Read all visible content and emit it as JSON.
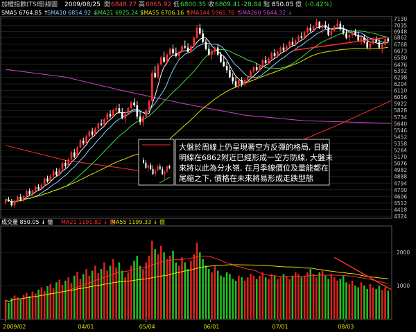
{
  "header": {
    "index_name": "加權指數(TSE)",
    "period": "日線圖",
    "date": "2009/08/25",
    "open_label": "開",
    "open": "6848.27",
    "high_label": "高",
    "high": "6865.92",
    "low_label": "低",
    "low": "6800.35",
    "close_label": "收",
    "close": "6809.41",
    "change_label": "點",
    "change": "-28.84",
    "volume": "850.05",
    "volume_unit": "億",
    "change_pct": "(-0.42%)"
  },
  "ma_legend": [
    {
      "label": "SMA5",
      "value": "6764.85",
      "arrow": "↑",
      "color": "#ffffff"
    },
    {
      "label": "SMA10",
      "value": "6854.92",
      "arrow": "↓",
      "color": "#7fd0ff"
    },
    {
      "label": "SMA21",
      "value": "6925.24",
      "arrow": "↓",
      "color": "#3fdc3f"
    },
    {
      "label": "SMA55",
      "value": "6706.16",
      "arrow": "↑",
      "color": "#e0e000"
    },
    {
      "label": "SMA144",
      "value": "5965.76",
      "arrow": "↑",
      "color": "#ff3030"
    },
    {
      "label": "SMA260",
      "value": "5644.32",
      "arrow": "↓",
      "color": "#d040d0"
    }
  ],
  "volume_legend": [
    {
      "label": "成交量",
      "value": "850.05",
      "arrow": "↓",
      "unit": "億",
      "color": "#ffffff"
    },
    {
      "label": "MA21",
      "value": "1191.82",
      "arrow": "↓",
      "unit": "億",
      "color": "#ff3030"
    },
    {
      "label": "MA55",
      "value": "1199.33",
      "arrow": "↓",
      "unit": "億",
      "color": "#e0e000"
    }
  ],
  "annotation": {
    "lines": [
      "大盤於周線上仍呈現著空方反彈的格局, 日線",
      "明線在6862附近已經形成一空方防線, 大盤未",
      "來將以此為分水嶺, 在月季線價位及量能都在",
      "尾縮之下, 價格在未來將易形成走跌型態"
    ]
  },
  "chart_data": {
    "type": "candlestick",
    "price_axis": {
      "ticks": [
        "7130",
        "7035",
        "6948",
        "6862",
        "6768",
        "6673",
        "6580",
        "6476",
        "6392",
        "6298",
        "6204",
        "6110",
        "6016",
        "5922",
        "5828",
        "5734",
        "5640",
        "5546",
        "5452",
        "5358",
        "5264",
        "5170",
        "5076",
        "4982",
        "4888",
        "4794",
        "4700",
        "4606",
        "4512",
        "4418",
        "4324"
      ],
      "range": [
        4324,
        7130
      ]
    },
    "volume_axis": {
      "ticks": [
        "2000",
        "1000"
      ],
      "range": [
        0,
        2400
      ]
    },
    "date_labels": [
      "2009/02",
      "04/01",
      "05/04",
      "06/01",
      "07/01",
      "08/03"
    ],
    "date_label_positions": [
      0,
      26.5,
      47,
      68.5,
      91.5,
      113.5
    ],
    "num_bars": 129,
    "candles": [
      [
        4520,
        4580,
        4490,
        4560
      ],
      [
        4560,
        4600,
        4530,
        4540
      ],
      [
        4540,
        4570,
        4460,
        4480
      ],
      [
        4480,
        4560,
        4450,
        4540
      ],
      [
        4540,
        4620,
        4520,
        4600
      ],
      [
        4600,
        4640,
        4540,
        4560
      ],
      [
        4560,
        4620,
        4530,
        4610
      ],
      [
        4610,
        4700,
        4600,
        4680
      ],
      [
        4680,
        4720,
        4620,
        4640
      ],
      [
        4640,
        4700,
        4610,
        4690
      ],
      [
        4690,
        4760,
        4670,
        4740
      ],
      [
        4740,
        4780,
        4690,
        4710
      ],
      [
        4710,
        4790,
        4700,
        4770
      ],
      [
        4770,
        4880,
        4760,
        4860
      ],
      [
        4860,
        4900,
        4800,
        4820
      ],
      [
        4820,
        4920,
        4810,
        4900
      ],
      [
        4900,
        4990,
        4880,
        4960
      ],
      [
        4960,
        5010,
        4890,
        4910
      ],
      [
        4910,
        5010,
        4900,
        4990
      ],
      [
        4990,
        5100,
        4980,
        5080
      ],
      [
        5080,
        5120,
        5010,
        5040
      ],
      [
        5040,
        5150,
        5030,
        5130
      ],
      [
        5130,
        5250,
        5120,
        5230
      ],
      [
        5230,
        5280,
        5150,
        5170
      ],
      [
        5170,
        5320,
        5160,
        5300
      ],
      [
        5300,
        5420,
        5290,
        5400
      ],
      [
        5400,
        5440,
        5330,
        5360
      ],
      [
        5360,
        5480,
        5350,
        5460
      ],
      [
        5460,
        5550,
        5440,
        5530
      ],
      [
        5530,
        5580,
        5460,
        5480
      ],
      [
        5480,
        5590,
        5470,
        5570
      ],
      [
        5570,
        5660,
        5550,
        5640
      ],
      [
        5640,
        5700,
        5600,
        5620
      ],
      [
        5620,
        5720,
        5600,
        5700
      ],
      [
        5700,
        5800,
        5680,
        5780
      ],
      [
        5780,
        5830,
        5720,
        5740
      ],
      [
        5740,
        5850,
        5730,
        5830
      ],
      [
        5830,
        5900,
        5790,
        5860
      ],
      [
        5860,
        5920,
        5780,
        5800
      ],
      [
        5800,
        5860,
        5700,
        5720
      ],
      [
        5720,
        5800,
        5650,
        5780
      ],
      [
        5780,
        5880,
        5760,
        5860
      ],
      [
        5860,
        5960,
        5840,
        5940
      ],
      [
        5940,
        6000,
        5880,
        5900
      ],
      [
        5900,
        5960,
        5700,
        5740
      ],
      [
        5740,
        5800,
        5620,
        5660
      ],
      [
        5660,
        5760,
        5600,
        5740
      ],
      [
        5740,
        5850,
        5720,
        5830
      ],
      [
        5830,
        5980,
        5820,
        5960
      ],
      [
        5960,
        6400,
        5950,
        6360
      ],
      [
        6360,
        6460,
        6280,
        6300
      ],
      [
        6300,
        6500,
        6280,
        6480
      ],
      [
        6480,
        6600,
        6460,
        6580
      ],
      [
        6580,
        6660,
        6500,
        6520
      ],
      [
        6520,
        6640,
        6500,
        6620
      ],
      [
        6620,
        6720,
        6600,
        6700
      ],
      [
        6700,
        6760,
        6620,
        6640
      ],
      [
        6640,
        6720,
        6580,
        6600
      ],
      [
        6600,
        6680,
        6540,
        6660
      ],
      [
        6660,
        6760,
        6640,
        6740
      ],
      [
        6740,
        6820,
        6700,
        6720
      ],
      [
        6720,
        6780,
        6640,
        6660
      ],
      [
        6660,
        6760,
        6640,
        6740
      ],
      [
        6740,
        6880,
        6720,
        6860
      ],
      [
        6860,
        7040,
        6840,
        7000
      ],
      [
        7000,
        7060,
        6900,
        6920
      ],
      [
        6920,
        6980,
        6780,
        6800
      ],
      [
        6800,
        6840,
        6680,
        6700
      ],
      [
        6700,
        6760,
        6600,
        6620
      ],
      [
        6620,
        6700,
        6540,
        6660
      ],
      [
        6660,
        6740,
        6620,
        6720
      ],
      [
        6720,
        6760,
        6600,
        6620
      ],
      [
        6620,
        6660,
        6500,
        6520
      ],
      [
        6520,
        6600,
        6440,
        6460
      ],
      [
        6460,
        6520,
        6360,
        6400
      ],
      [
        6400,
        6460,
        6280,
        6300
      ],
      [
        6300,
        6360,
        6200,
        6240
      ],
      [
        6240,
        6300,
        6150,
        6170
      ],
      [
        6170,
        6280,
        6140,
        6260
      ],
      [
        6260,
        6300,
        6160,
        6200
      ],
      [
        6200,
        6280,
        6170,
        6260
      ],
      [
        6260,
        6320,
        6220,
        6300
      ],
      [
        6300,
        6400,
        6280,
        6380
      ],
      [
        6380,
        6460,
        6360,
        6440
      ],
      [
        6440,
        6500,
        6380,
        6400
      ],
      [
        6400,
        6480,
        6380,
        6460
      ],
      [
        6460,
        6560,
        6440,
        6540
      ],
      [
        6540,
        6600,
        6480,
        6500
      ],
      [
        6500,
        6580,
        6480,
        6560
      ],
      [
        6560,
        6660,
        6540,
        6640
      ],
      [
        6640,
        6700,
        6580,
        6600
      ],
      [
        6600,
        6680,
        6580,
        6660
      ],
      [
        6660,
        6740,
        6640,
        6720
      ],
      [
        6720,
        6780,
        6660,
        6680
      ],
      [
        6680,
        6760,
        6660,
        6740
      ],
      [
        6740,
        6820,
        6720,
        6800
      ],
      [
        6800,
        6860,
        6740,
        6760
      ],
      [
        6760,
        6840,
        6740,
        6820
      ],
      [
        6820,
        6900,
        6800,
        6880
      ],
      [
        6880,
        6940,
        6840,
        6860
      ],
      [
        6860,
        6960,
        6840,
        6940
      ],
      [
        6940,
        7020,
        6920,
        7000
      ],
      [
        7000,
        7060,
        6940,
        6960
      ],
      [
        6960,
        7040,
        6940,
        7020
      ],
      [
        7020,
        7130,
        7000,
        7080
      ],
      [
        7080,
        7100,
        6980,
        7000
      ],
      [
        7000,
        7060,
        6920,
        7040
      ],
      [
        7040,
        7100,
        6980,
        7000
      ],
      [
        7000,
        7060,
        6880,
        6900
      ],
      [
        6900,
        6980,
        6840,
        6960
      ],
      [
        6960,
        7040,
        6940,
        7020
      ],
      [
        7020,
        7120,
        7000,
        7060
      ],
      [
        7060,
        7100,
        6960,
        6980
      ],
      [
        6980,
        7040,
        6900,
        6920
      ],
      [
        6920,
        6980,
        6840,
        6860
      ],
      [
        6860,
        6920,
        6800,
        6900
      ],
      [
        6900,
        6960,
        6860,
        6940
      ],
      [
        6940,
        6980,
        6880,
        6900
      ],
      [
        6900,
        6940,
        6800,
        6820
      ],
      [
        6820,
        6880,
        6760,
        6860
      ],
      [
        6860,
        6900,
        6780,
        6800
      ],
      [
        6800,
        6860,
        6700,
        6720
      ],
      [
        6720,
        6800,
        6680,
        6780
      ],
      [
        6780,
        6860,
        6760,
        6840
      ],
      [
        6840,
        6880,
        6780,
        6800
      ],
      [
        6800,
        6840,
        6700,
        6720
      ],
      [
        6720,
        6780,
        6640,
        6760
      ],
      [
        6760,
        6860,
        6740,
        6840
      ],
      [
        6848.27,
        6865.92,
        6800.35,
        6809.41
      ]
    ],
    "volume": [
      560,
      480,
      620,
      700,
      650,
      580,
      720,
      780,
      690,
      820,
      760,
      880,
      950,
      840,
      980,
      1050,
      920,
      1100,
      1180,
      1020,
      1150,
      1250,
      1080,
      1300,
      1420,
      1200,
      1350,
      1500,
      1300,
      1450,
      1600,
      1380,
      1500,
      1700,
      1450,
      1600,
      1800,
      1550,
      1700,
      1450,
      1250,
      1400,
      1600,
      1750,
      1900,
      1600,
      1500,
      1700,
      1900,
      2350,
      2100,
      1950,
      2200,
      2000,
      1800,
      1900,
      2050,
      1700,
      1600,
      1850,
      1700,
      1500,
      1750,
      1950,
      2300,
      2000,
      1800,
      1600,
      1500,
      1400,
      1600,
      1450,
      1300,
      1250,
      1400,
      1350,
      1200,
      1150,
      1300,
      1250,
      1150,
      1250,
      1350,
      1300,
      1200,
      1300,
      1400,
      1250,
      1200,
      1350,
      1300,
      1200,
      1250,
      1350,
      1280,
      1200,
      1300,
      1400,
      1350,
      1250,
      1300,
      1400,
      1500,
      1350,
      1250,
      1400,
      1450,
      1300,
      1200,
      1350,
      1250,
      1150,
      1200,
      1300,
      1100,
      1050,
      1150,
      1000,
      950,
      1100,
      1000,
      900,
      1050,
      950,
      900,
      1000,
      880,
      950,
      850.05
    ],
    "trend_lines": [
      {
        "name": "price-downtrend",
        "from": [
          96,
          6680
        ],
        "to": [
          127,
          6860
        ],
        "color": "#ff3030"
      },
      {
        "name": "volume-downtrend",
        "from": [
          110,
          1850
        ],
        "to": [
          129,
          880
        ],
        "color": "#ff3030"
      }
    ],
    "long_ma_lines": [
      {
        "name": "sma260",
        "points": [
          [
            0,
            6410
          ],
          [
            20,
            6300
          ],
          [
            40,
            6100
          ],
          [
            60,
            5920
          ],
          [
            80,
            5760
          ],
          [
            100,
            5680
          ],
          [
            129,
            5644
          ]
        ],
        "color": "#d040d0"
      },
      {
        "name": "sma144",
        "points": [
          [
            0,
            5330
          ],
          [
            20,
            5120
          ],
          [
            40,
            5000
          ],
          [
            55,
            4900
          ],
          [
            70,
            5010
          ],
          [
            90,
            5240
          ],
          [
            110,
            5600
          ],
          [
            129,
            5965
          ]
        ],
        "color": "#ff3030"
      }
    ],
    "ylabel": "",
    "xlabel": ""
  }
}
